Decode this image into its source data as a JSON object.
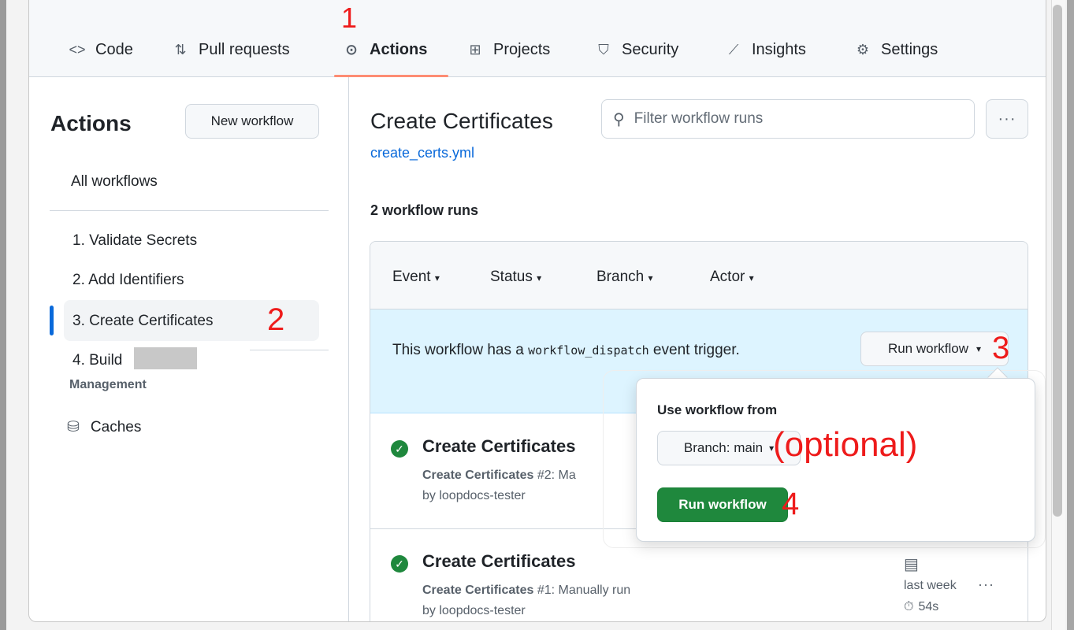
{
  "nav": {
    "items": [
      {
        "label": "Code",
        "icon": "code-icon"
      },
      {
        "label": "Pull requests",
        "icon": "pull-request-icon"
      },
      {
        "label": "Actions",
        "icon": "play-icon"
      },
      {
        "label": "Projects",
        "icon": "table-icon"
      },
      {
        "label": "Security",
        "icon": "shield-icon"
      },
      {
        "label": "Insights",
        "icon": "graph-icon"
      },
      {
        "label": "Settings",
        "icon": "gear-icon"
      }
    ],
    "active": "Actions"
  },
  "annotations": {
    "a1": "1",
    "a2": "2",
    "a3": "3",
    "a4": "4",
    "optional": "(optional)"
  },
  "sidebar": {
    "title": "Actions",
    "new_workflow": "New workflow",
    "all_workflows": "All workflows",
    "workflows": [
      "1. Validate Secrets",
      "2. Add Identifiers",
      "3. Create Certificates",
      "4. Build"
    ],
    "management_label": "Management",
    "caches": "Caches"
  },
  "main": {
    "title": "Create Certificates",
    "file": "create_certs.yml",
    "filter_placeholder": "Filter workflow runs",
    "more": "···",
    "runs_count": "2 workflow runs",
    "filters": [
      "Event",
      "Status",
      "Branch",
      "Actor"
    ],
    "banner_prefix": "This workflow has a ",
    "banner_code": "workflow_dispatch",
    "banner_suffix": " event trigger.",
    "run_workflow_btn": "Run workflow"
  },
  "runs": [
    {
      "title": "Create Certificates",
      "bold": "Create Certificates",
      "detail": " #2: Ma",
      "by": "by loopdocs-tester"
    },
    {
      "title": "Create Certificates",
      "bold": "Create Certificates",
      "detail": " #1: Manually run",
      "by": "by loopdocs-tester",
      "when": "last week",
      "duration": "54s"
    }
  ],
  "dropdown": {
    "label": "Use workflow from",
    "branch": "Branch: main",
    "run": "Run workflow"
  },
  "colors": {
    "accent": "#0969da",
    "green": "#1f883d",
    "annotation": "#ee1b1b",
    "underline": "#fd8c73"
  }
}
